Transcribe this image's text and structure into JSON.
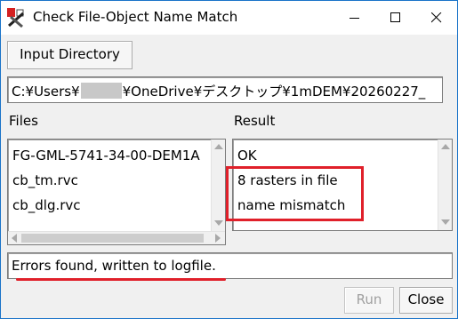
{
  "window": {
    "title": "Check File-Object Name Match"
  },
  "toolbar": {
    "input_directory_label": "Input Directory"
  },
  "path": {
    "prefix": "C:¥Users¥",
    "suffix": "¥OneDrive¥デスクトップ¥1mDEM¥20260227_"
  },
  "files": {
    "label": "Files",
    "items": [
      "FG-GML-5741-34-00-DEM1A",
      "cb_tm.rvc",
      "cb_dlg.rvc"
    ]
  },
  "result": {
    "label": "Result",
    "items": [
      "OK",
      "8 rasters in file",
      "name mismatch"
    ]
  },
  "status": {
    "message": "Errors found, written to logfile."
  },
  "buttons": {
    "run": "Run",
    "close": "Close"
  },
  "colors": {
    "annotation": "#e0202a",
    "title_bar": "#ffffff",
    "window_border": "#1a73c9"
  },
  "icons": {
    "app": "app-logo-icon",
    "minimize": "minimize-icon",
    "maximize": "maximize-icon",
    "close": "close-icon"
  }
}
